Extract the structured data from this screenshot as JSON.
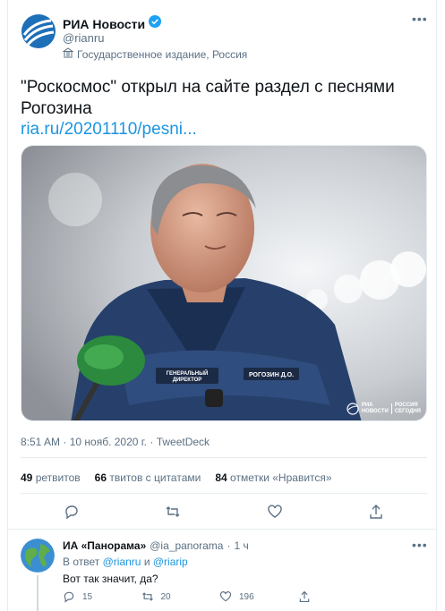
{
  "tweet": {
    "author_name": "РИА Новости",
    "author_handle": "@rianru",
    "account_label": "Государственное издание, Россия",
    "text": "\"Роскосмос\" открыл на сайте раздел с песнями Рогозина",
    "link": "ria.ru/20201110/pesni...",
    "photo_badge_text": [
      "ГЕНЕРАЛЬНЫЙ",
      "ДИРЕКТОР"
    ],
    "photo_name_badge": "РОГОЗИН Д.О.",
    "photo_watermark": [
      "РИА",
      "НОВОСТИ"
    ],
    "photo_watermark_right": [
      "РОССИЯ",
      "СЕГОДНЯ"
    ],
    "time": "8:51 AM",
    "date": "10 нояб. 2020 г.",
    "source": "TweetDeck",
    "separator": "·"
  },
  "stats": {
    "retweets_count": "49",
    "retweets_label": "ретвитов",
    "quotes_count": "66",
    "quotes_label": "твитов с цитатами",
    "likes_count": "84",
    "likes_label": "отметки «Нравится»"
  },
  "reply": {
    "author_name": "ИА «Панорама»",
    "author_handle": "@ia_panorama",
    "time": "1 ч",
    "reply_prefix": "В ответ",
    "mention_1": "@rianru",
    "conj": "и",
    "mention_2": "@riarip",
    "text": "Вот так значит, да?",
    "replies": "15",
    "retweets": "20",
    "likes": "196"
  },
  "icons": {
    "verified": "verified-badge-icon",
    "label": "government-building-icon",
    "reply": "reply-icon",
    "retweet": "retweet-icon",
    "like": "heart-icon",
    "share": "share-icon",
    "more": "more-dots-icon"
  },
  "colors": {
    "link": "#1b95e0",
    "muted": "#5b7083",
    "divider": "#e6ecf0"
  }
}
